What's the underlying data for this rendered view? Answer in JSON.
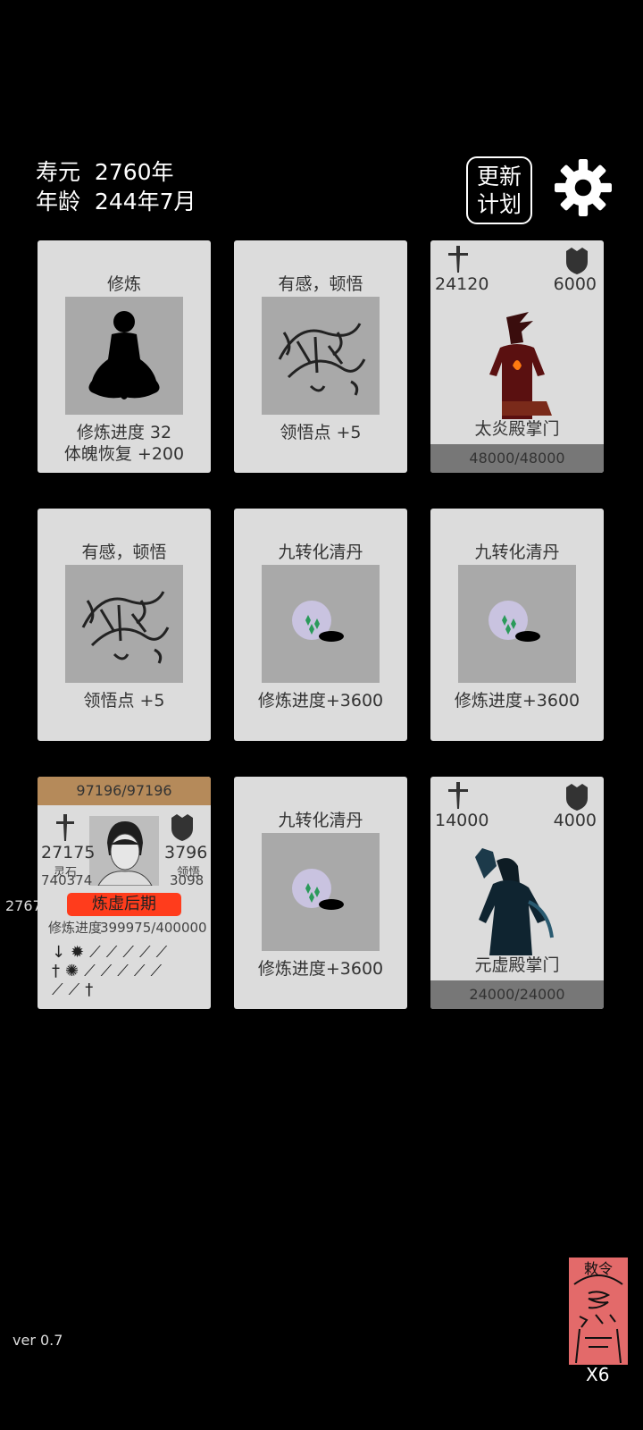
{
  "header": {
    "lifespan_label": "寿元",
    "lifespan_value": "2760年",
    "age_label": "年龄",
    "age_value": "244年7月",
    "plan_button_line1": "更新",
    "plan_button_line2": "计划",
    "settings_icon": "gear-icon"
  },
  "cards": {
    "c1": {
      "title": "修炼",
      "line1": "修炼进度  32",
      "line2": "体魄恢复  +200",
      "icon": "meditation-silhouette"
    },
    "c2": {
      "title": "有感，顿悟",
      "line1": "领悟点  +5",
      "icon": "calligraphy-swirl"
    },
    "c3": {
      "attack": "24120",
      "defense": "6000",
      "name": "太炎殿掌门",
      "hp": "48000/48000",
      "icon": "fire-demon"
    },
    "c4": {
      "title": "有感，顿悟",
      "line1": "领悟点  +5",
      "icon": "calligraphy-swirl"
    },
    "c5": {
      "title": "九转化清丹",
      "line1": "修炼进度+3600",
      "icon": "pill-orb"
    },
    "c6": {
      "title": "九转化清丹",
      "line1": "修炼进度+3600",
      "icon": "pill-orb"
    },
    "c8": {
      "title": "九转化清丹",
      "line1": "修炼进度+3600",
      "icon": "pill-orb"
    },
    "c9": {
      "attack": "14000",
      "defense": "4000",
      "name": "元虚殿掌门",
      "hp": "24000/24000",
      "icon": "shadow-cultivator"
    }
  },
  "player": {
    "hp": "97196/97196",
    "attack": "27175",
    "defense": "3796",
    "spirit_stone_label": "灵石",
    "spirit_stone_value": "740374",
    "insight_label": "领悟",
    "insight_value": "3098",
    "realm": "炼虚后期",
    "progress_label": "修炼进度",
    "progress_value": "399975/400000",
    "weapons_row1": "↓✹⟋⟋⟋⟋⟋",
    "weapons_row2": "†✺⟋⟋⟋⟋⟋",
    "weapons_row3": "⟋⟋†"
  },
  "side_number": "2767",
  "footer": {
    "version": "ver 0.7",
    "talisman_text": "敕令",
    "talisman_count": "X6"
  },
  "colors": {
    "card_bg": "#dcdcdc",
    "realm_badge": "#ff3c1c",
    "talisman": "#e36a6a",
    "player_hp_bar": "#b58a5a"
  }
}
